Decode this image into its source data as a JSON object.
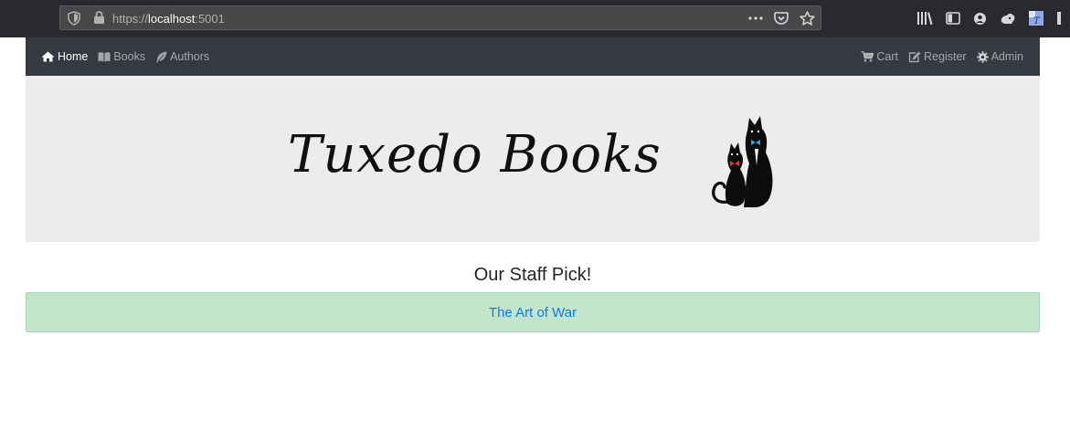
{
  "browser": {
    "url_scheme": "https://",
    "url_host": "localhost",
    "url_port": ":5001",
    "icons": {
      "tracking": "shield-icon",
      "lock": "lock-icon",
      "page_actions": "ellipsis-icon",
      "pocket": "pocket-icon",
      "bookmark": "star-icon",
      "library": "library-icon",
      "sidebar": "sidebar-icon",
      "account": "account-icon",
      "extension": "extension-icon",
      "translate": "translate-icon"
    }
  },
  "navbar": {
    "left": [
      {
        "label": "Home",
        "icon": "home-icon",
        "active": true
      },
      {
        "label": "Books",
        "icon": "book-icon",
        "active": false
      },
      {
        "label": "Authors",
        "icon": "feather-icon",
        "active": false
      }
    ],
    "right": [
      {
        "label": "Cart",
        "icon": "cart-icon"
      },
      {
        "label": "Register",
        "icon": "edit-icon"
      },
      {
        "label": "Admin",
        "icon": "gear-icon"
      }
    ]
  },
  "banner": {
    "brand": "Tuxedo Books"
  },
  "staff_pick": {
    "heading": "Our Staff Pick!",
    "book_title": "The Art of War"
  },
  "colors": {
    "navbar_bg": "#343a40",
    "banner_bg": "#ececec",
    "pick_bg": "#c3e6cb",
    "link": "#007bff"
  }
}
